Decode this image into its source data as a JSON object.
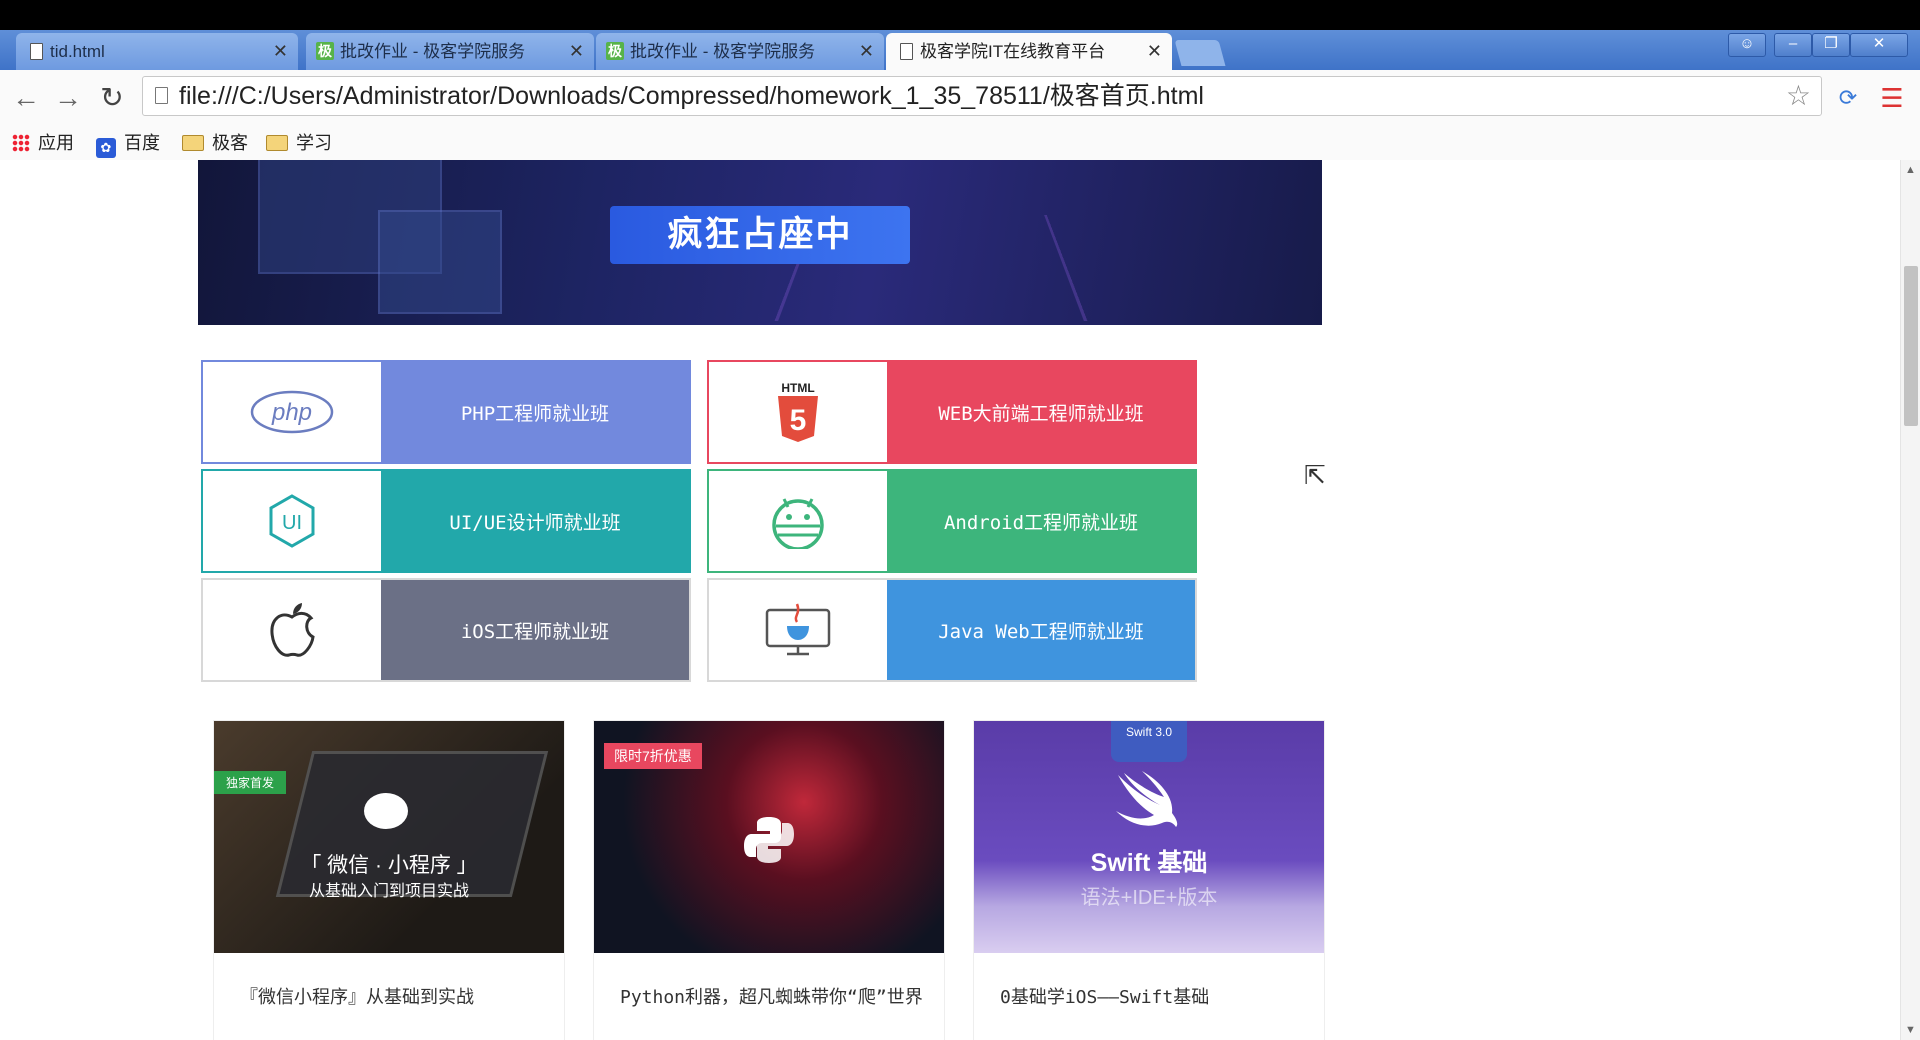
{
  "browser": {
    "tabs": [
      {
        "title": "tid.html",
        "icon": "page-icon",
        "active": false
      },
      {
        "title": "批改作业 - 极客学院服务",
        "icon": "geek-favicon",
        "active": false
      },
      {
        "title": "批改作业 - 极客学院服务",
        "icon": "geek-favicon",
        "active": false
      },
      {
        "title": "极客学院IT在线教育平台",
        "icon": "page-icon",
        "active": true
      }
    ],
    "url": "file:///C:/Users/Administrator/Downloads/Compressed/homework_1_35_78511/极客首页.html",
    "bookmarks": [
      {
        "label": "应用",
        "icon": "apps-icon"
      },
      {
        "label": "百度",
        "icon": "baidu-icon"
      },
      {
        "label": "极客",
        "icon": "folder-icon"
      },
      {
        "label": "学习",
        "icon": "folder-icon"
      }
    ],
    "geek_favicon_text": "极"
  },
  "banner": {
    "button": "疯狂占座中"
  },
  "courses": [
    {
      "label": "PHP工程师就业班",
      "logo": "php-logo-icon",
      "logo_text": "php",
      "color": "#7289dd"
    },
    {
      "label": "WEB大前端工程师就业班",
      "logo": "html5-logo-icon",
      "logo_text": "HTML",
      "color": "#e8475f"
    },
    {
      "label": "UI/UE设计师就业班",
      "logo": "ui-logo-icon",
      "logo_text": "UI",
      "color": "#22a8aa"
    },
    {
      "label": "Android工程师就业班",
      "logo": "android-logo-icon",
      "logo_text": "",
      "color": "#3db57c"
    },
    {
      "label": "iOS工程师就业班",
      "logo": "apple-logo-icon",
      "logo_text": "",
      "color": "#6b7086"
    },
    {
      "label": "Java Web工程师就业班",
      "logo": "java-logo-icon",
      "logo_text": "",
      "color": "#3f94de"
    }
  ],
  "cards": [
    {
      "title": "『微信小程序』从基础到实战",
      "badge": "独家首发",
      "thumb_line1": "「 微信 · 小程序 」",
      "thumb_line2": "从基础入门到项目实战"
    },
    {
      "title": "Python利器，超凡蜘蛛带你“爬”世界",
      "badge": "限时7折优惠"
    },
    {
      "title": "0基础学iOS——Swift基础",
      "badge": "Swift 3.0",
      "thumb_line1": "Swift 基础",
      "thumb_line2": "语法+IDE+版本"
    }
  ]
}
